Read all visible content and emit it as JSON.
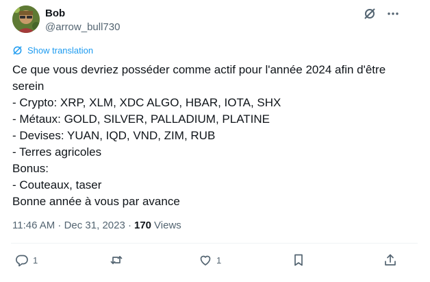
{
  "author": {
    "name": "Bob",
    "handle": "@arrow_bull730"
  },
  "top_icons": [
    "grok-icon",
    "more-icon"
  ],
  "translation": {
    "label": "Show translation"
  },
  "tweet": {
    "lines": [
      "Ce que vous devriez posséder comme actif pour l'année 2024 afin d'être",
      "serein",
      "- Crypto: XRP, XLM, XDC ALGO, HBAR, IOTA, SHX",
      "- Métaux: GOLD, SILVER, PALLADIUM, PLATINE",
      "- Devises: YUAN, IQD, VND, ZIM, RUB",
      "- Terres agricoles",
      "Bonus:",
      "- Couteaux, taser",
      "Bonne année à vous par avance"
    ]
  },
  "meta": {
    "timestamp": "11:46 AM · Dec 31, 2023 ·",
    "views_count": "170",
    "views_label": "Views"
  },
  "actions": {
    "reply_count": "1",
    "retweet_count": "",
    "like_count": "1"
  },
  "colors": {
    "accent": "#1d9bf0",
    "text": "#0f1419",
    "muted": "#536471"
  }
}
